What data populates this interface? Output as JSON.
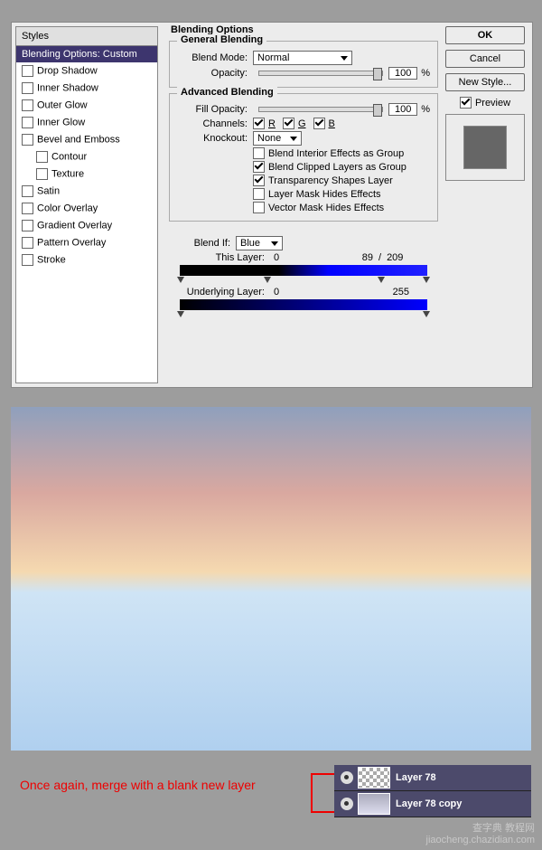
{
  "dialog": {
    "title": "Blending Options",
    "styles_header": "Styles",
    "styles": [
      {
        "label": "Blending Options: Custom",
        "sel": true,
        "cb": false
      },
      {
        "label": "Drop Shadow",
        "sel": false,
        "cb": true
      },
      {
        "label": "Inner Shadow",
        "sel": false,
        "cb": true
      },
      {
        "label": "Outer Glow",
        "sel": false,
        "cb": true
      },
      {
        "label": "Inner Glow",
        "sel": false,
        "cb": true
      },
      {
        "label": "Bevel and Emboss",
        "sel": false,
        "cb": true
      },
      {
        "label": "Contour",
        "sel": false,
        "cb": true,
        "sub": true
      },
      {
        "label": "Texture",
        "sel": false,
        "cb": true,
        "sub": true
      },
      {
        "label": "Satin",
        "sel": false,
        "cb": true
      },
      {
        "label": "Color Overlay",
        "sel": false,
        "cb": true
      },
      {
        "label": "Gradient Overlay",
        "sel": false,
        "cb": true
      },
      {
        "label": "Pattern Overlay",
        "sel": false,
        "cb": true
      },
      {
        "label": "Stroke",
        "sel": false,
        "cb": true
      }
    ],
    "general": {
      "title": "General Blending",
      "blend_mode_label": "Blend Mode:",
      "blend_mode": "Normal",
      "opacity_label": "Opacity:",
      "opacity": "100",
      "pct": "%"
    },
    "advanced": {
      "title": "Advanced Blending",
      "fill_label": "Fill Opacity:",
      "fill": "100",
      "pct": "%",
      "channels_label": "Channels:",
      "r": "R",
      "g": "G",
      "b": "B",
      "knockout_label": "Knockout:",
      "knockout": "None",
      "c1": "Blend Interior Effects as Group",
      "c2": "Blend Clipped Layers as Group",
      "c3": "Transparency Shapes Layer",
      "c4": "Layer Mask Hides Effects",
      "c5": "Vector Mask Hides Effects"
    },
    "blendif": {
      "label": "Blend If:",
      "channel": "Blue",
      "this_label": "This Layer:",
      "this_a": "0",
      "this_b": "89",
      "slash": "/",
      "this_c": "209",
      "under_label": "Underlying Layer:",
      "under_a": "0",
      "under_b": "255"
    },
    "buttons": {
      "ok": "OK",
      "cancel": "Cancel",
      "new_style": "New Style...",
      "preview": "Preview"
    }
  },
  "annotation": "Once again, merge with a blank new layer",
  "layers": [
    {
      "name": "Layer 78"
    },
    {
      "name": "Layer 78 copy"
    }
  ],
  "watermark": {
    "l1": "查字典 教程网",
    "l2": "jiaocheng.chazidian.com"
  }
}
